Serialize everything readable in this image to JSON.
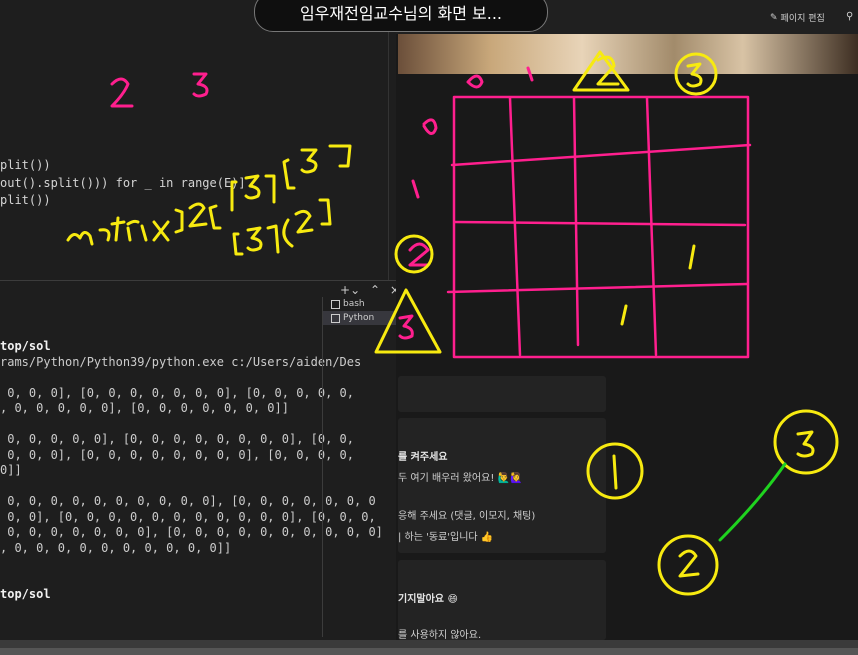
{
  "window": {
    "title": "임우재전임교수님의 화면 보..."
  },
  "notion": {
    "edit_page_label": "페이지 편집",
    "cards": [
      {
        "lines": [
          "를 켜주세요",
          "두 여기 배우러 왔어요! 🙋‍♂️🙋‍♀️",
          "",
          "응해 주세요 (댓글, 이모지, 채팅)",
          "| 하는 '동료'입니다 👍"
        ]
      },
      {
        "lines": [
          "기지말아요 😄",
          "",
          "를 사용하지 않아요."
        ]
      }
    ]
  },
  "editor": {
    "lines": [
      "plit())",
      "out().split())) for _ in range(E)]",
      "plit())"
    ]
  },
  "terminal": {
    "tabs": [
      {
        "label": "bash",
        "selected": false
      },
      {
        "label": "Python",
        "selected": true
      }
    ],
    "lines": [
      {
        "text": "top/sol",
        "path": true
      },
      {
        "text": "rams/Python/Python39/python.exe c:/Users/aiden/Des",
        "path": false
      },
      {
        "text": "",
        "path": false
      },
      {
        "text": " 0, 0, 0], [0, 0, 0, 0, 0, 0, 0], [0, 0, 0, 0, 0,",
        "path": false
      },
      {
        "text": ", 0, 0, 0, 0, 0], [0, 0, 0, 0, 0, 0, 0]]",
        "path": false
      },
      {
        "text": "",
        "path": false
      },
      {
        "text": " 0, 0, 0, 0, 0], [0, 0, 0, 0, 0, 0, 0, 0], [0, 0,",
        "path": false
      },
      {
        "text": " 0, 0, 0], [0, 0, 0, 0, 0, 0, 0, 0], [0, 0, 0, 0,",
        "path": false
      },
      {
        "text": "0]]",
        "path": false
      },
      {
        "text": "",
        "path": false
      },
      {
        "text": " 0, 0, 0, 0, 0, 0, 0, 0, 0, 0], [0, 0, 0, 0, 0, 0, 0",
        "path": false
      },
      {
        "text": " 0, 0], [0, 0, 0, 0, 0, 0, 0, 0, 0, 0, 0], [0, 0, 0,",
        "path": false
      },
      {
        "text": " 0, 0, 0, 0, 0, 0, 0], [0, 0, 0, 0, 0, 0, 0, 0, 0, 0]",
        "path": false
      },
      {
        "text": ", 0, 0, 0, 0, 0, 0, 0, 0, 0, 0]]",
        "path": false
      },
      {
        "text": "",
        "path": false
      },
      {
        "text": "",
        "path": false
      },
      {
        "text": "top/sol",
        "path": true
      }
    ]
  },
  "annotations": {
    "top_numbers": [
      "2",
      "3"
    ],
    "matrix_text": "matrix[2][3]",
    "matrix_text2": "[3][2]",
    "col_labels": [
      "0",
      "1",
      "2",
      "3"
    ],
    "row_labels": [
      "0",
      "1",
      "2",
      "3"
    ],
    "grid_marks": [
      "1",
      "1"
    ],
    "node_labels": [
      "1",
      "3",
      "2"
    ]
  },
  "colors": {
    "pink": "#ff1f8e",
    "yellow": "#f7ea10",
    "green": "#1fd31f"
  }
}
